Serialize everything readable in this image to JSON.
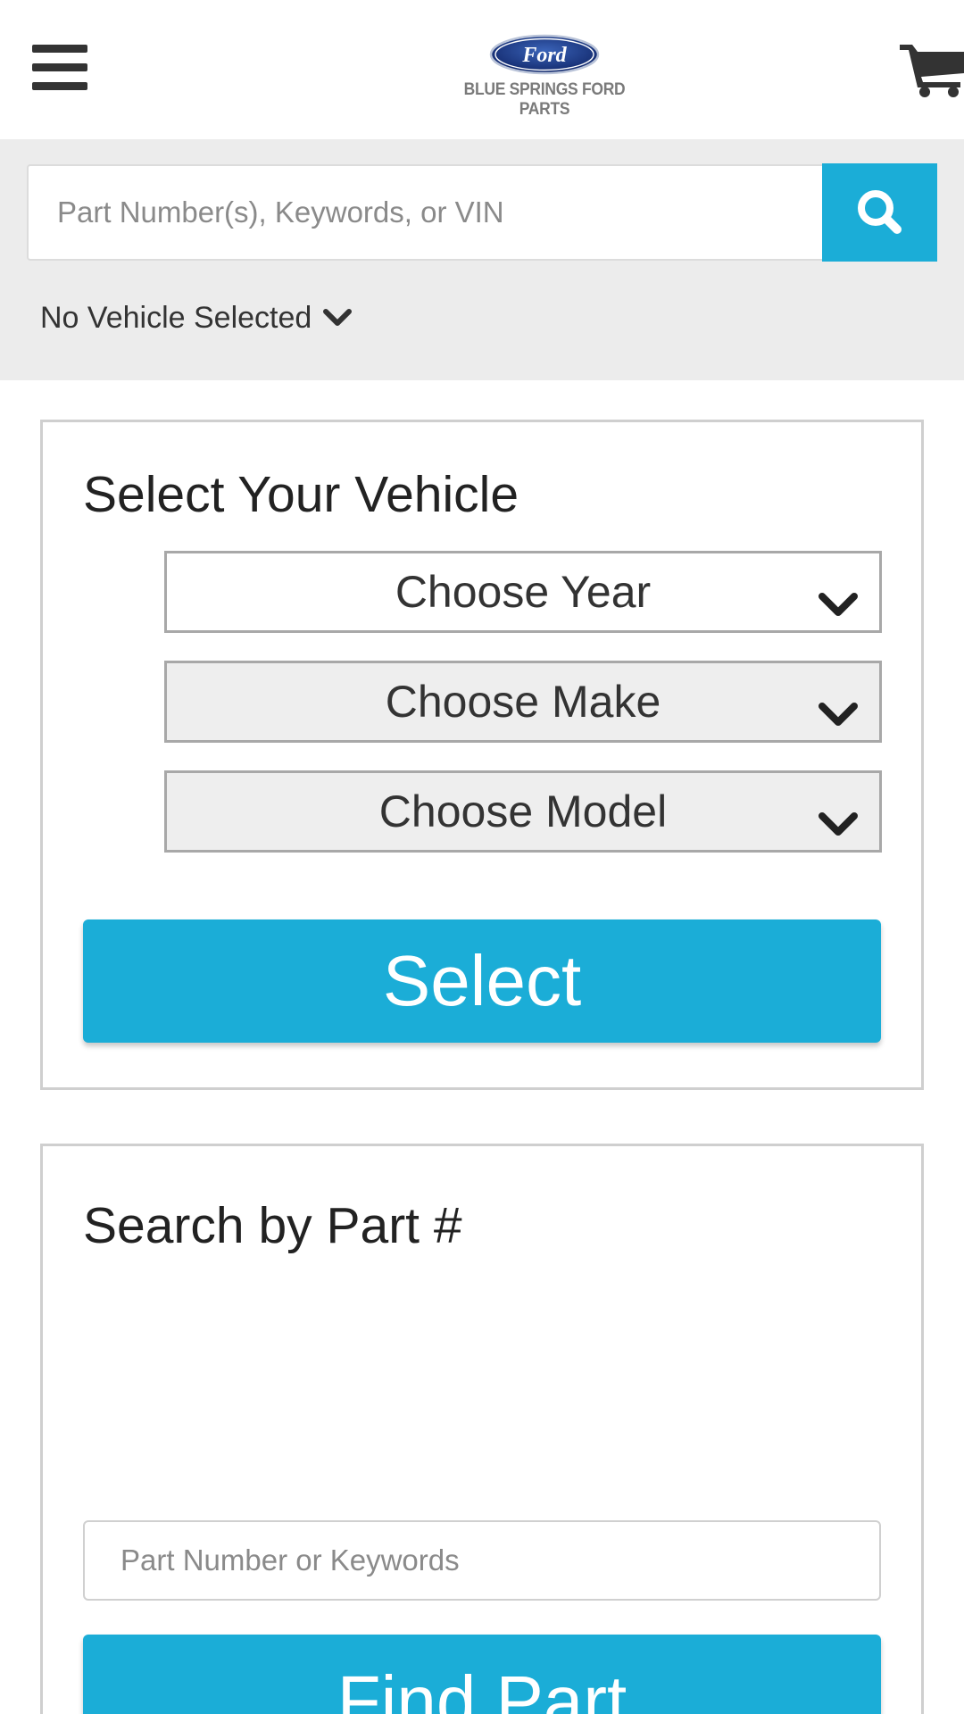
{
  "header": {
    "menu_icon": "hamburger-menu-icon",
    "logo_emblem_text": "Ford",
    "logo_subtitle": "BLUE SPRINGS FORD PARTS",
    "cart_icon": "shopping-cart-icon"
  },
  "search": {
    "placeholder": "Part Number(s), Keywords, or VIN",
    "value": "",
    "button_icon": "search-icon"
  },
  "vehicle_status": {
    "label": "No Vehicle Selected",
    "icon": "chevron-down-icon"
  },
  "select_vehicle": {
    "title": "Select Your Vehicle",
    "year_label": "Choose Year",
    "make_label": "Choose Make",
    "model_label": "Choose Model",
    "button_label": "Select"
  },
  "search_by_part": {
    "title": "Search by Part #",
    "placeholder": "Part Number or Keywords",
    "value": "",
    "button_label": "Find Part"
  },
  "colors": {
    "accent": "#1badd7",
    "band": "#ececec",
    "text": "#333333",
    "logo_blue": "#1f3d8a"
  }
}
